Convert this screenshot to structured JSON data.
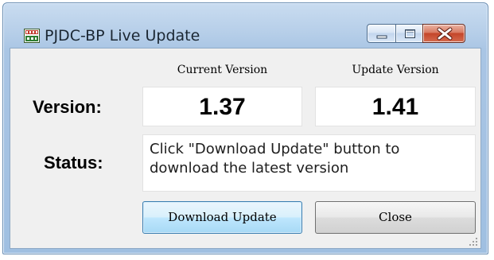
{
  "window": {
    "title": "PJDC-BP Live Update"
  },
  "titlebar_buttons": {
    "minimize_icon": "minimize-icon",
    "maximize_icon": "maximize-icon",
    "close_icon": "close-icon"
  },
  "version": {
    "label": "Version:",
    "current_header": "Current Version",
    "update_header": "Update Version",
    "current_value": "1.37",
    "update_value": "1.41"
  },
  "status": {
    "label": "Status:",
    "message": "Click \"Download Update\" button to download the latest version"
  },
  "buttons": {
    "download_label": "Download Update",
    "close_label": "Close"
  },
  "colors": {
    "frame": "#a9c5e4",
    "client": "#f0f0f0",
    "close_button": "#c4462a",
    "focus_button": "#bee6fd"
  }
}
